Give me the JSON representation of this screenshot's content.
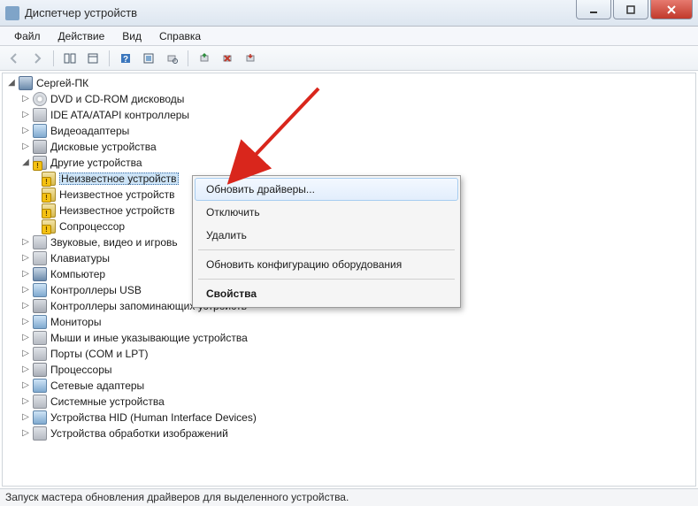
{
  "window": {
    "title": "Диспетчер устройств"
  },
  "menu": {
    "file": "Файл",
    "action": "Действие",
    "view": "Вид",
    "help": "Справка"
  },
  "tree": {
    "root": "Сергей-ПК",
    "items": [
      {
        "label": "DVD и CD-ROM дисководы",
        "icon": "disc"
      },
      {
        "label": "IDE ATA/ATAPI контроллеры",
        "icon": "ide"
      },
      {
        "label": "Видеоадаптеры",
        "icon": "video"
      },
      {
        "label": "Дисковые устройства",
        "icon": "hdd"
      },
      {
        "label": "Другие устройства",
        "icon": "other",
        "expanded": true,
        "children": [
          {
            "label": "Неизвестное устройств",
            "warn": true,
            "selected": true
          },
          {
            "label": "Неизвестное устройств",
            "warn": true
          },
          {
            "label": "Неизвестное устройств",
            "warn": true
          },
          {
            "label": "Сопроцессор",
            "warn": true
          }
        ]
      },
      {
        "label": "Звуковые, видео и игровь",
        "icon": "sound"
      },
      {
        "label": "Клавиатуры",
        "icon": "kb"
      },
      {
        "label": "Компьютер",
        "icon": "computer"
      },
      {
        "label": "Контроллеры USB",
        "icon": "usb"
      },
      {
        "label": "Контроллеры запоминающих устройств",
        "icon": "hdd"
      },
      {
        "label": "Мониторы",
        "icon": "monitor"
      },
      {
        "label": "Мыши и иные указывающие устройства",
        "icon": "mouse"
      },
      {
        "label": "Порты (COM и LPT)",
        "icon": "port"
      },
      {
        "label": "Процессоры",
        "icon": "cpu"
      },
      {
        "label": "Сетевые адаптеры",
        "icon": "net"
      },
      {
        "label": "Системные устройства",
        "icon": "sys"
      },
      {
        "label": "Устройства HID (Human Interface Devices)",
        "icon": "hid"
      },
      {
        "label": "Устройства обработки изображений",
        "icon": "img"
      }
    ]
  },
  "context_menu": {
    "update": "Обновить драйверы...",
    "disable": "Отключить",
    "delete": "Удалить",
    "rescan": "Обновить конфигурацию оборудования",
    "props": "Свойства"
  },
  "statusbar": {
    "text": "Запуск мастера обновления драйверов для выделенного устройства."
  }
}
